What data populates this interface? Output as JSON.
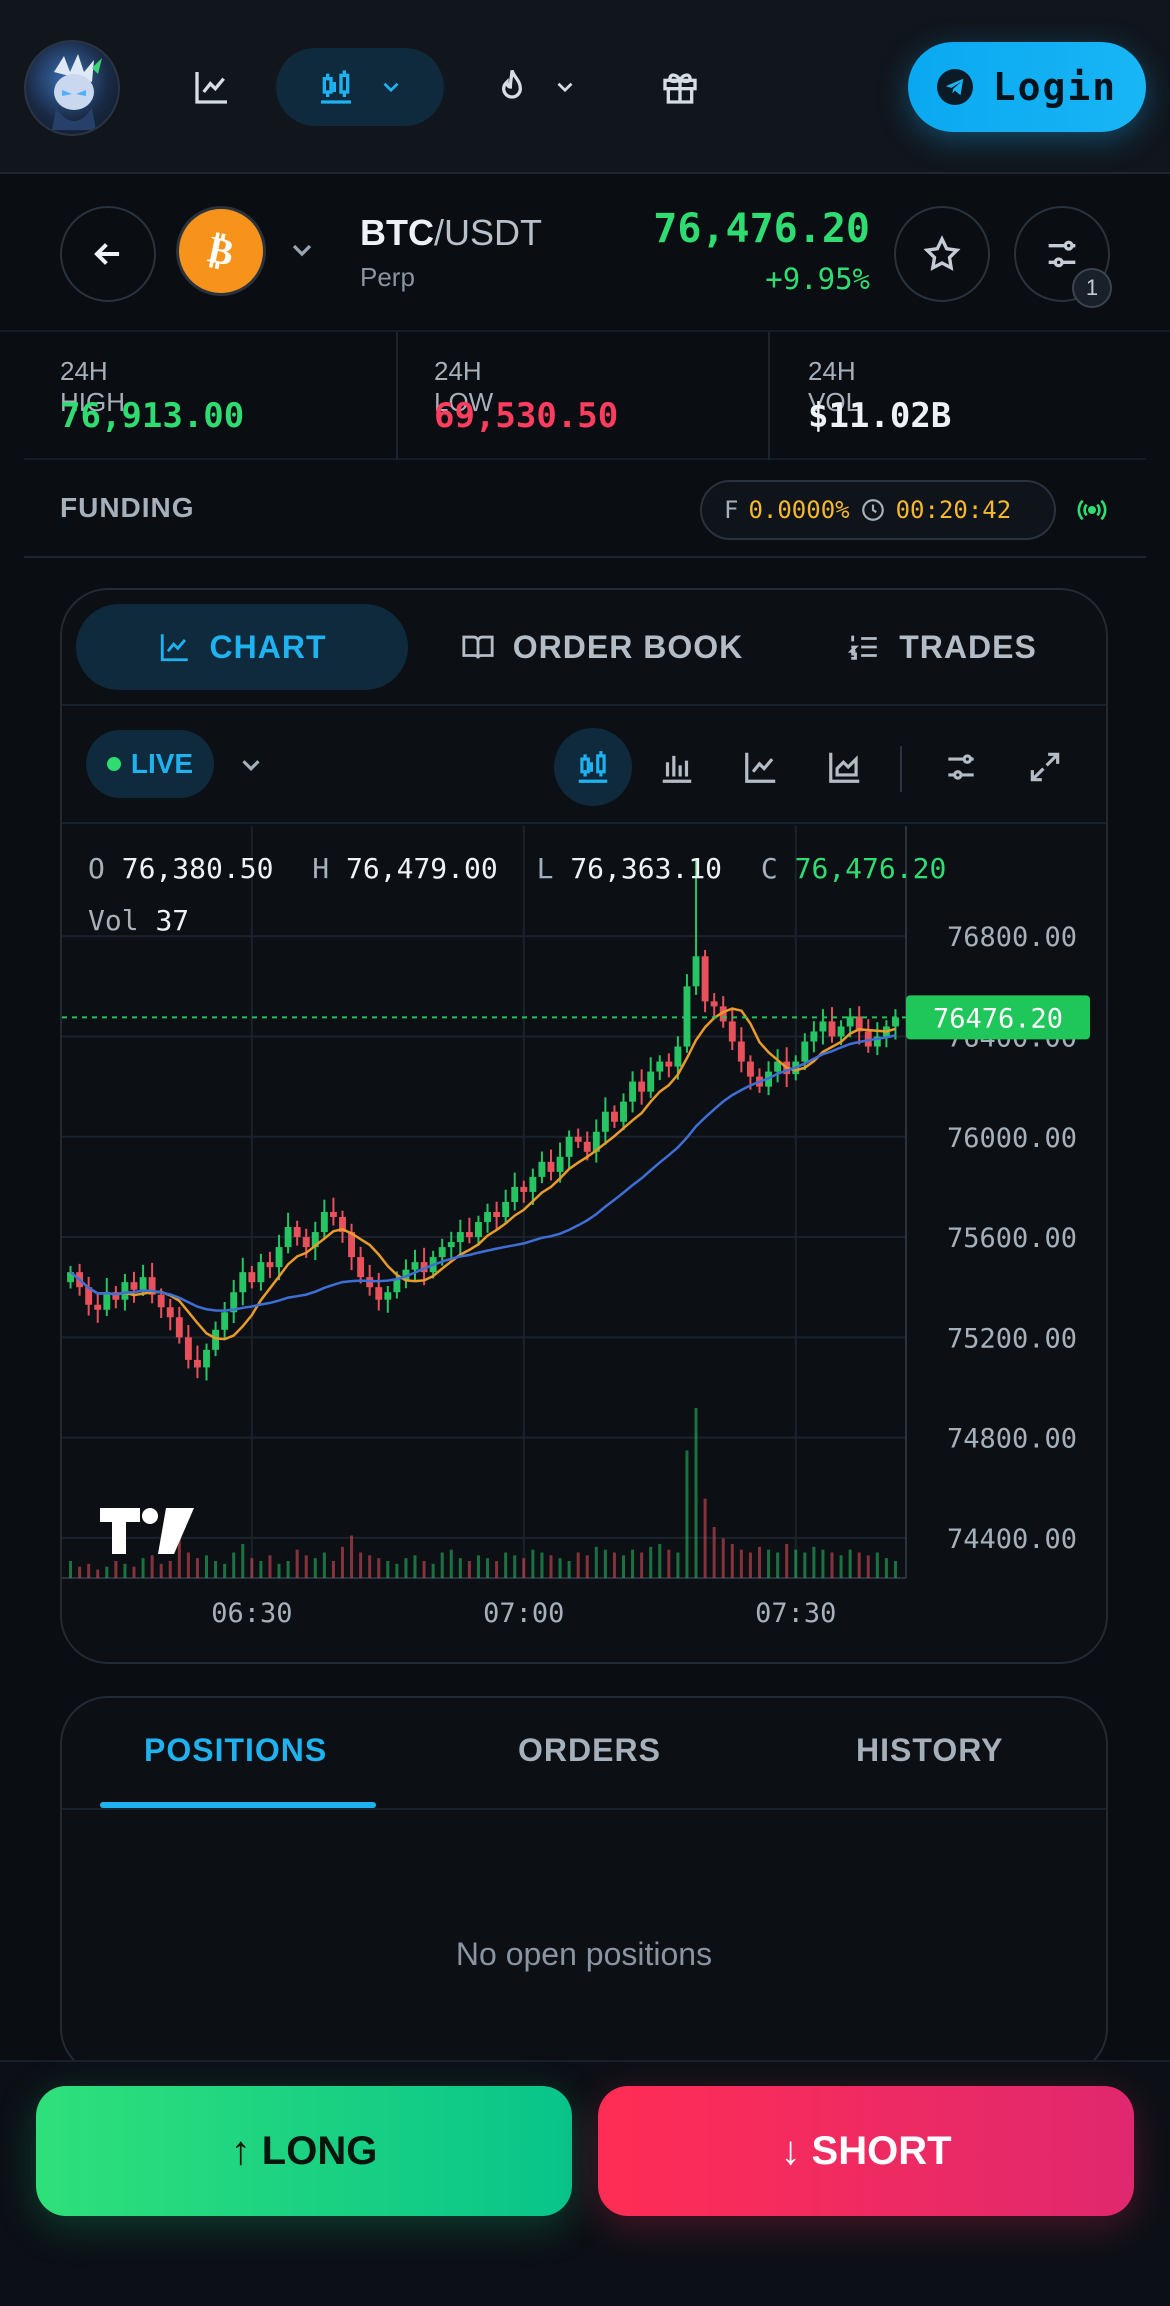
{
  "topbar": {
    "login_label": "Login",
    "icons": [
      "line-chart-icon",
      "candlestick-icon",
      "flame-icon",
      "gift-icon",
      "telegram-icon"
    ]
  },
  "pair": {
    "base": "BTC",
    "quote": "/USDT",
    "subtitle": "Perp",
    "price": "76,476.20",
    "change": "+9.95%",
    "filter_badge": "1"
  },
  "stats": {
    "high_label": "24H HIGH",
    "high_value": "76,913.00",
    "low_label": "24H LOW",
    "low_value": "69,530.50",
    "vol_label": "24H VOL",
    "vol_value": "$11.02B"
  },
  "funding": {
    "label": "FUNDING",
    "prefix": "F",
    "rate": "0.0000%",
    "countdown": "00:20:42"
  },
  "chart_tabs": {
    "chart": "CHART",
    "order_book": "ORDER BOOK",
    "trades": "TRADES"
  },
  "toolbar": {
    "live_label": "LIVE"
  },
  "ohlc": {
    "o_label": "O",
    "o": "76,380.50",
    "h_label": "H",
    "h": "76,479.00",
    "l_label": "L",
    "l": "76,363.10",
    "c_label": "C",
    "c": "76,476.20",
    "vol_label": "Vol",
    "vol": "37"
  },
  "chart_data": {
    "type": "candlestick",
    "y_ticks": [
      "76800.00",
      "76400.00",
      "76000.00",
      "75600.00",
      "75200.00",
      "74800.00",
      "74400.00"
    ],
    "y_tick_values": [
      76800,
      76400,
      76000,
      75600,
      75200,
      74800,
      74400
    ],
    "ylim": [
      74240,
      77120
    ],
    "x_ticks": [
      "06:30",
      "07:00",
      "07:30"
    ],
    "x_tick_index": [
      20,
      50,
      80
    ],
    "current_price_label": "76476.20",
    "current_price": 76476.2,
    "grid": true,
    "colors": {
      "up": "#26c462",
      "down": "#e8515b",
      "ma_fast": "#e89b2a",
      "ma_slow": "#3d6fd6",
      "last": "#1fc65a"
    },
    "closes": [
      75460,
      75400,
      75330,
      75310,
      75380,
      75350,
      75420,
      75390,
      75440,
      75370,
      75320,
      75280,
      75200,
      75110,
      75080,
      75150,
      75230,
      75300,
      75380,
      75460,
      75420,
      75500,
      75480,
      75560,
      75640,
      75600,
      75560,
      75620,
      75700,
      75680,
      75620,
      75520,
      75440,
      75400,
      75350,
      75380,
      75430,
      75470,
      75500,
      75460,
      75520,
      75560,
      75580,
      75620,
      75600,
      75660,
      75700,
      75680,
      75740,
      75800,
      75780,
      75840,
      75900,
      75860,
      75920,
      76000,
      75980,
      75940,
      76020,
      76100,
      76060,
      76140,
      76220,
      76180,
      76260,
      76300,
      76280,
      76360,
      76600,
      76720,
      76540,
      76520,
      76460,
      76380,
      76300,
      76240,
      76200,
      76260,
      76300,
      76250,
      76300,
      76380,
      76420,
      76460,
      76400,
      76440,
      76480,
      76420,
      76360,
      76400,
      76440,
      76476
    ],
    "volumes": [
      6,
      4,
      5,
      3,
      4,
      6,
      5,
      4,
      7,
      8,
      5,
      6,
      14,
      9,
      7,
      8,
      6,
      5,
      9,
      12,
      7,
      6,
      8,
      5,
      6,
      10,
      8,
      7,
      9,
      6,
      11,
      15,
      9,
      8,
      7,
      6,
      5,
      7,
      8,
      6,
      5,
      9,
      10,
      7,
      6,
      8,
      7,
      6,
      9,
      8,
      7,
      10,
      9,
      8,
      7,
      6,
      9,
      8,
      11,
      10,
      9,
      8,
      10,
      9,
      11,
      12,
      10,
      9,
      45,
      60,
      28,
      18,
      14,
      12,
      10,
      9,
      11,
      10,
      9,
      12,
      10,
      9,
      11,
      10,
      9,
      8,
      10,
      9,
      8,
      9,
      7,
      6
    ]
  },
  "positions": {
    "tab_positions": "POSITIONS",
    "tab_orders": "ORDERS",
    "tab_history": "HISTORY",
    "empty_text": "No open positions"
  },
  "actions": {
    "long_label": "↑ LONG",
    "short_label": "↓ SHORT"
  }
}
